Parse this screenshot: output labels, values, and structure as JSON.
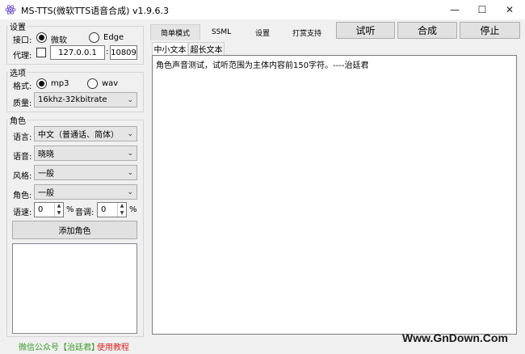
{
  "window": {
    "title": "MS-TTS(微软TTS语音合成) v1.9.6.3",
    "min_label": "—",
    "max_label": "☐",
    "close_label": "✕"
  },
  "settings": {
    "group_label": "设置",
    "interface_label": "接口:",
    "interface_options": [
      "微软",
      "Edge"
    ],
    "interface_selected": "微软",
    "proxy_label": "代理:",
    "proxy_checked": false,
    "proxy_host": "127.0.0.1",
    "proxy_port": "10809",
    "colon": ":"
  },
  "options": {
    "group_label": "选项",
    "format_label": "格式:",
    "format_options": [
      "mp3",
      "wav"
    ],
    "format_selected": "mp3",
    "quality_label": "质量:",
    "quality_value": "16khz-32kbitrate"
  },
  "role": {
    "group_label": "角色",
    "language_label": "语言:",
    "language_value": "中文（普通话、简体）",
    "voice_label": "语音:",
    "voice_value": "晓晓",
    "style_label": "风格:",
    "style_value": "一般",
    "role_label": "角色:",
    "role_value": "一般",
    "rate_label": "语速:",
    "rate_value": "0",
    "percent": "%",
    "pitch_label": "音调:",
    "pitch_value": "0",
    "add_role_label": "添加角色"
  },
  "tabs": [
    "简单模式",
    "SSML",
    "设置",
    "打赏支持"
  ],
  "active_tab": "简单模式",
  "actions": {
    "preview_label": "试听",
    "synthesize_label": "合成",
    "stop_label": "停止"
  },
  "text_tabs": [
    "中小文本",
    "超长文本"
  ],
  "active_text_tab": "中小文本",
  "editor_text": "角色声音测试，试听范围为主体内容前150字符。----治廷君",
  "footer": {
    "wechat_text": "微信公众号【治廷君】",
    "tutorial_text": "使用教程",
    "wechat_color": "#3a9a2a",
    "tutorial_color": "#e02020"
  },
  "watermark": "Www.GnDown.Com"
}
